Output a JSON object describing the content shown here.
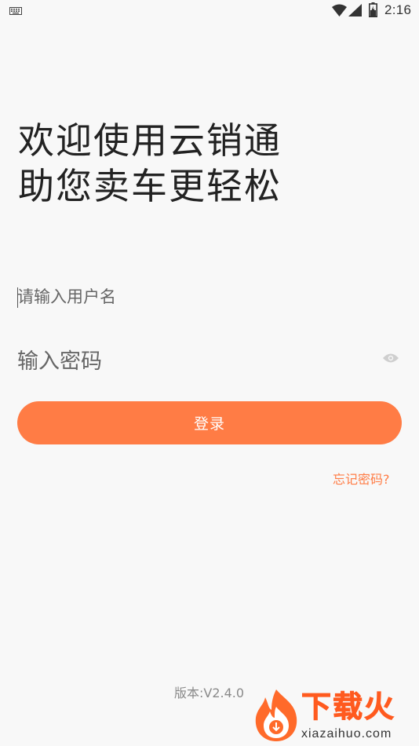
{
  "status_bar": {
    "time": "2:16",
    "icons": [
      "keyboard-icon",
      "wifi-icon",
      "signal-icon",
      "battery-icon"
    ]
  },
  "headline": {
    "line1": "欢迎使用云销通",
    "line2": "助您卖车更轻松"
  },
  "login_form": {
    "username_placeholder": "请输入用户名",
    "username_value": "",
    "password_placeholder": "输入密码",
    "password_value": "",
    "password_toggle_icon": "eye-icon",
    "login_label": "登录",
    "forgot_label": "忘记密码?"
  },
  "footer": {
    "version": "版本:V2.4.0"
  },
  "watermark": {
    "brand": "下载火",
    "domain": "xiazaihuo.com"
  },
  "colors": {
    "accent": "#ff7c45",
    "background": "#f8f8f8",
    "text": "#222222"
  }
}
